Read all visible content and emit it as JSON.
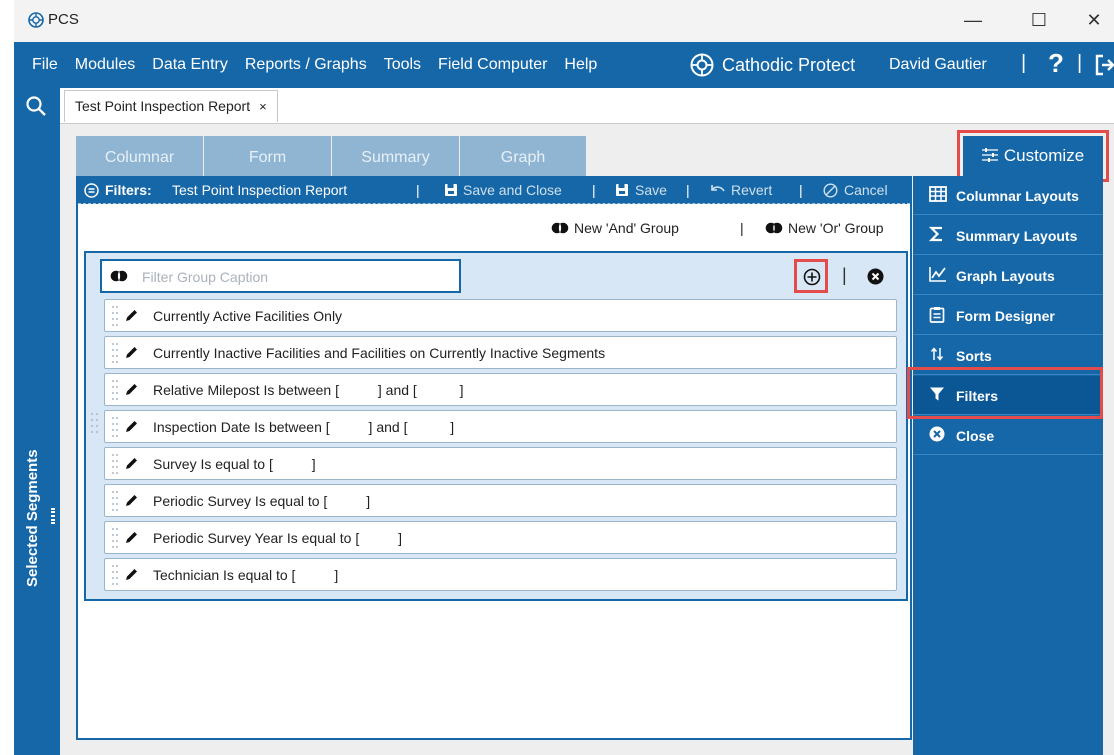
{
  "window": {
    "title": "PCS",
    "minimize": "—",
    "maximize": "☐",
    "close": "✕"
  },
  "menubar": {
    "items": [
      "File",
      "Modules",
      "Data Entry",
      "Reports / Graphs",
      "Tools",
      "Field Computer",
      "Help"
    ],
    "brand": "Cathodic Protect",
    "user": "David Gautier",
    "separator": "|",
    "help_label": "?"
  },
  "sidebar": {
    "label": "Selected Segments"
  },
  "doc_tab": {
    "label": "Test Point Inspection Report",
    "close": "×"
  },
  "view_tabs": [
    "Columnar",
    "Form",
    "Summary",
    "Graph"
  ],
  "customize_label": "Customize",
  "filter_toolbar": {
    "prefix": "Filters:",
    "report_name": "Test Point Inspection Report",
    "save_and_close": "Save and Close",
    "save": "Save",
    "revert": "Revert",
    "cancel": "Cancel"
  },
  "group_buttons": {
    "and_group": "New 'And' Group",
    "or_group": "New 'Or' Group"
  },
  "filter_group": {
    "caption_placeholder": "Filter Group Caption",
    "rows": [
      "Currently Active Facilities Only",
      "Currently Inactive Facilities and Facilities on Currently Inactive Segments",
      "Relative Milepost Is between [          ] and [           ]",
      "Inspection Date Is between [          ] and [           ]",
      "Survey Is equal to [          ]",
      "Periodic Survey Is equal to [          ]",
      "Periodic Survey Year Is equal to [          ]",
      "Technician Is equal to [          ]"
    ]
  },
  "right_panel": {
    "items": [
      "Columnar Layouts",
      "Summary Layouts",
      "Graph Layouts",
      "Form Designer",
      "Sorts",
      "Filters",
      "Close"
    ],
    "active": "Filters"
  },
  "colors": {
    "primary_blue": "#1567a8",
    "tab_inactive": "#8fb5d3",
    "group_bg": "#d7e7f5",
    "highlight_red": "#e44b4b"
  }
}
